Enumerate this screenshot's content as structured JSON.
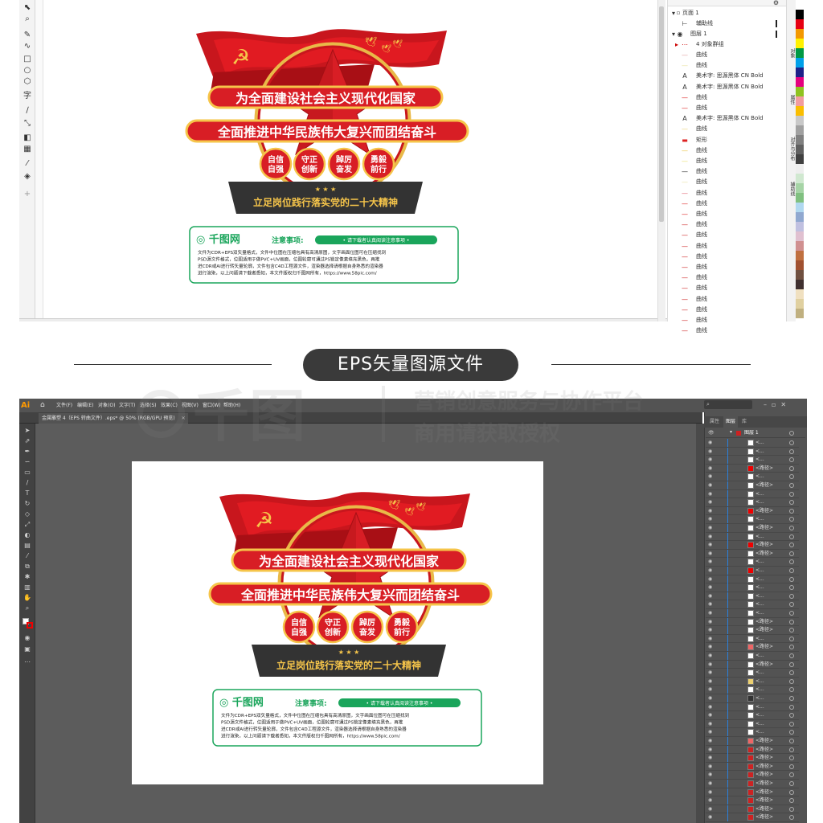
{
  "corel": {
    "objects_panel": {
      "page_label": "页面 1",
      "guides_label": "辅助线",
      "layer_label": "图层 1",
      "group_label": "4 对象群组",
      "rows": [
        {
          "icon": "curve-icon",
          "label": "曲线"
        },
        {
          "icon": "curve-icon",
          "label": "曲线"
        },
        {
          "icon": "text-icon",
          "label": "美术字: 思源黑体 CN Bold"
        },
        {
          "icon": "text-icon",
          "label": "美术字: 思源黑体 CN Bold"
        },
        {
          "icon": "curve-icon",
          "label": "曲线"
        },
        {
          "icon": "curve-icon",
          "label": "曲线"
        },
        {
          "icon": "text-icon",
          "label": "美术字: 思源黑体 CN Bold"
        },
        {
          "icon": "curve-icon",
          "label": "曲线"
        },
        {
          "icon": "rect-icon",
          "label": "矩形"
        },
        {
          "icon": "curve-icon",
          "label": "曲线"
        },
        {
          "icon": "curve-icon",
          "label": "曲线"
        },
        {
          "icon": "curve-icon",
          "label": "曲线"
        },
        {
          "icon": "curve-icon",
          "label": "曲线"
        },
        {
          "icon": "curve-icon",
          "label": "曲线"
        },
        {
          "icon": "curve-icon",
          "label": "曲线"
        },
        {
          "icon": "curve-icon",
          "label": "曲线"
        },
        {
          "icon": "curve-icon",
          "label": "曲线"
        },
        {
          "icon": "curve-icon",
          "label": "曲线"
        },
        {
          "icon": "curve-icon",
          "label": "曲线"
        },
        {
          "icon": "curve-icon",
          "label": "曲线"
        },
        {
          "icon": "curve-icon",
          "label": "曲线"
        },
        {
          "icon": "curve-icon",
          "label": "曲线"
        },
        {
          "icon": "curve-icon",
          "label": "曲线"
        },
        {
          "icon": "curve-icon",
          "label": "曲线"
        },
        {
          "icon": "curve-icon",
          "label": "曲线"
        },
        {
          "icon": "curve-icon",
          "label": "曲线"
        },
        {
          "icon": "curve-icon",
          "label": "曲线"
        }
      ],
      "row_colors": [
        "#e0a0a0",
        "#e8e0a0",
        "#333",
        "#333",
        "#d22",
        "#d22",
        "#333",
        "#e8d070",
        "#d22",
        "#e8c040",
        "#e8e070",
        "#222",
        "#e8e0a0",
        "#e06070",
        "#d22",
        "#d22",
        "#c22",
        "#c22",
        "#c22",
        "#c22",
        "#c22",
        "#c22",
        "#c22",
        "#c22",
        "#c22",
        "#c22",
        "#c22"
      ]
    },
    "right_tabs": [
      "对象",
      "属性",
      "对齐与分布",
      "辅助线"
    ],
    "palette": [
      "#ffffff",
      "#000000",
      "#e60012",
      "#f39800",
      "#fff100",
      "#009944",
      "#00a0e9",
      "#1d2088",
      "#e4007f",
      "#8fc31f",
      "#f29c9f",
      "#fabe00",
      "#c8c8c8",
      "#a0a0a0",
      "#808080",
      "#606060",
      "#404040",
      "#eeeeee",
      "#d0e8d0",
      "#a6d4a6",
      "#80c080",
      "#b0d8f0",
      "#90a8d0",
      "#c0c0e0",
      "#e0c0d0",
      "#d09090",
      "#c07040",
      "#a05030",
      "#705040",
      "#403030",
      "#f0e0c0",
      "#e0d0a0",
      "#c0b080"
    ]
  },
  "poster": {
    "line1": "为全面建设社会主义现代化国家",
    "line2": "全面推进中华民族伟大复兴而团结奋斗",
    "badges": [
      [
        "自信",
        "自强"
      ],
      [
        "守正",
        "创新"
      ],
      [
        "踔厉",
        "奋发"
      ],
      [
        "勇毅",
        "前行"
      ]
    ],
    "stars": "★ ★ ★",
    "base_text": "立足岗位践行落实党的二十大精神",
    "notice": {
      "brand": "千图网",
      "title": "注意事项:",
      "pill": "• 请下载者认真阅读注意事项 •",
      "body": "文件为CDR+EPS双矢量格式，文件中位图在压缩包具有高清原图，文字画面位图可在压缩找到PSD源文件格式，位图适用于做PVC+UV画面，位图轮廓可通过PS锁定像素填充黑色，再推进CDR或AI进行转矢量轮廓，文件包含C4D工程源文件，渲染器选择请根据自身熟悉的渲染器进行渲染，以上问题请下载者悉知，本文件版权归千图网所有，https://www.58pic.com/"
    }
  },
  "banner": {
    "label": "EPS矢量图源文件"
  },
  "watermark": {
    "brand": "千图",
    "line1": "营销创意服务与协作平台",
    "line2": "商用请获取授权"
  },
  "illustrator": {
    "logo": "Ai",
    "menus": [
      "文件(F)",
      "编辑(E)",
      "对象(O)",
      "文字(T)",
      "选择(S)",
      "效果(C)",
      "视图(V)",
      "窗口(W)",
      "帮助(H)"
    ],
    "tab_title": "金属雕塑 4（EPS 转曲文件）.eps* @ 50% (RGB/GPU 预览)",
    "panel_tabs": [
      "属性",
      "图层",
      "库"
    ],
    "layer_name": "图层 1",
    "row_labels": [
      "<...",
      "<...",
      "<...",
      "<路径>",
      "<...",
      "<路径>",
      "<...",
      "<...",
      "<路径>",
      "<...",
      "<路径>",
      "<...",
      "<路径>",
      "<路径>",
      "<...",
      "<...",
      "<...",
      "<...",
      "<...",
      "<...",
      "<...",
      "<路径>",
      "<路径>",
      "<...",
      "<路径>",
      "<...",
      "<路径>",
      "<...",
      "<...",
      "<...",
      "<...",
      "<...",
      "<...",
      "<...",
      "<...",
      "<路径>",
      "<路径>",
      "<路径>",
      "<路径>",
      "<路径>",
      "<路径>",
      "<路径>",
      "<路径>",
      "<路径>",
      "<路径>",
      "<路径>"
    ],
    "row_thumbs": [
      "#fff",
      "#fff",
      "#fff",
      "#e00",
      "#fff",
      "#fff",
      "#fff",
      "#fff",
      "#e00",
      "#fff",
      "#fff",
      "#fff",
      "#e00",
      "#fff",
      "#fff",
      "#e00",
      "#fff",
      "#fff",
      "#fff",
      "#fff",
      "#fff",
      "#fff",
      "#fff",
      "#fff",
      "#e66",
      "#fff",
      "#fff",
      "#fff",
      "#ecd070",
      "#fff",
      "#333",
      "#fff",
      "#fff",
      "#fff",
      "#fff",
      "#e66",
      "#c22",
      "#c22",
      "#c22",
      "#c22",
      "#c22",
      "#c22",
      "#c22",
      "#c22",
      "#c22",
      "#c22"
    ]
  }
}
